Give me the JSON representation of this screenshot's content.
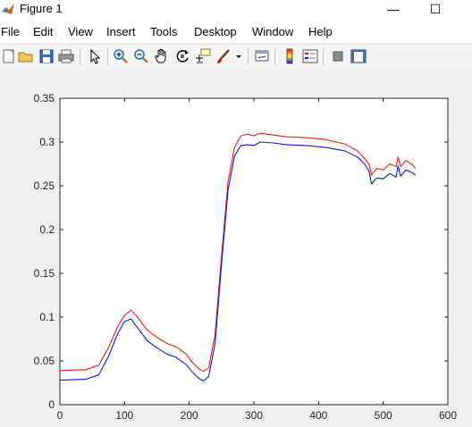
{
  "window": {
    "title": "Figure 1",
    "minimize_glyph": "—",
    "maximize_glyph": "☐"
  },
  "menu": [
    {
      "label": "File"
    },
    {
      "label": "Edit"
    },
    {
      "label": "View"
    },
    {
      "label": "Insert"
    },
    {
      "label": "Tools"
    },
    {
      "label": "Desktop"
    },
    {
      "label": "Window"
    },
    {
      "label": "Help"
    }
  ],
  "toolbar": {
    "icons": [
      "new-figure-icon",
      "open-file-icon",
      "save-icon",
      "print-icon",
      "pointer-icon",
      "zoom-in-icon",
      "zoom-out-icon",
      "pan-hand-icon",
      "rotate-3d-icon",
      "data-cursor-icon",
      "brush-icon",
      "brush-dropdown-icon",
      "link-plot-icon",
      "insert-colorbar-icon",
      "insert-legend-icon",
      "hide-plot-tools-icon",
      "show-plot-tools-icon"
    ]
  },
  "colors": {
    "series_red": "#ee1c1c",
    "series_blue": "#0a1ed2",
    "axes_bg": "#ffffff",
    "figure_bg": "#f0f0f0"
  },
  "chart_data": {
    "type": "line",
    "title": "",
    "xlabel": "",
    "ylabel": "",
    "xlim": [
      0,
      600
    ],
    "ylim": [
      0,
      0.35
    ],
    "xticks": [
      0,
      100,
      200,
      300,
      400,
      500,
      600
    ],
    "xtick_labels": [
      "0",
      "100",
      "200",
      "300",
      "400",
      "500",
      "600"
    ],
    "yticks": [
      0,
      0.05,
      0.1,
      0.15,
      0.2,
      0.25,
      0.3,
      0.35
    ],
    "ytick_labels": [
      "0",
      "0.05",
      "0.1",
      "0.15",
      "0.2",
      "0.25",
      "0.3",
      "0.35"
    ],
    "grid": false,
    "legend": "none",
    "series": [
      {
        "color": "#ee1c1c",
        "x": [
          0,
          40,
          60,
          75,
          90,
          100,
          110,
          120,
          135,
          150,
          165,
          180,
          195,
          205,
          215,
          222,
          230,
          240,
          250,
          260,
          270,
          280,
          290,
          300,
          310,
          330,
          350,
          380,
          410,
          440,
          460,
          470,
          478,
          482,
          490,
          500,
          510,
          520,
          523,
          527,
          535,
          545,
          550
        ],
        "y": [
          0.039,
          0.04,
          0.045,
          0.065,
          0.09,
          0.102,
          0.108,
          0.1,
          0.085,
          0.077,
          0.07,
          0.066,
          0.058,
          0.048,
          0.041,
          0.038,
          0.042,
          0.08,
          0.17,
          0.255,
          0.294,
          0.307,
          0.309,
          0.307,
          0.31,
          0.308,
          0.306,
          0.305,
          0.303,
          0.298,
          0.29,
          0.282,
          0.275,
          0.262,
          0.27,
          0.268,
          0.275,
          0.272,
          0.283,
          0.272,
          0.279,
          0.274,
          0.27
        ]
      },
      {
        "color": "#0a1ed2",
        "x": [
          0,
          40,
          60,
          75,
          90,
          100,
          110,
          120,
          135,
          150,
          165,
          180,
          195,
          205,
          215,
          222,
          230,
          240,
          250,
          260,
          270,
          280,
          290,
          300,
          310,
          330,
          350,
          380,
          410,
          440,
          460,
          470,
          478,
          482,
          490,
          500,
          510,
          520,
          523,
          527,
          535,
          545,
          550
        ],
        "y": [
          0.028,
          0.029,
          0.034,
          0.055,
          0.082,
          0.095,
          0.098,
          0.088,
          0.073,
          0.065,
          0.058,
          0.054,
          0.046,
          0.037,
          0.03,
          0.027,
          0.032,
          0.07,
          0.16,
          0.245,
          0.284,
          0.296,
          0.297,
          0.296,
          0.3,
          0.299,
          0.297,
          0.296,
          0.294,
          0.29,
          0.283,
          0.276,
          0.267,
          0.252,
          0.259,
          0.258,
          0.264,
          0.26,
          0.273,
          0.261,
          0.268,
          0.265,
          0.262
        ]
      }
    ]
  }
}
